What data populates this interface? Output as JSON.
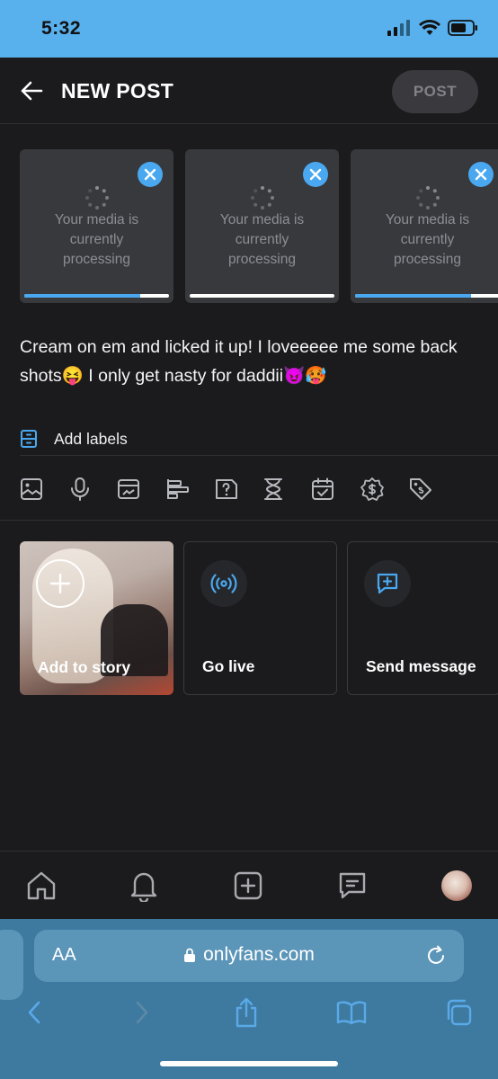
{
  "status_bar": {
    "time": "5:32"
  },
  "header": {
    "title": "NEW POST",
    "post_label": "POST"
  },
  "media": [
    {
      "text": "Your media is currently processing",
      "progress": 0.8
    },
    {
      "text": "Your media is currently processing",
      "progress": 1.0
    },
    {
      "text": "Your media is currently processing",
      "progress": 0.8
    }
  ],
  "caption": "Cream on em and licked it up! I loveeeee me some back shots😝 I only get nasty for daddii😈🥵",
  "labels": {
    "text": "Add labels"
  },
  "toolbar_icons": [
    "image-icon",
    "microphone-icon",
    "vault-icon",
    "poll-icon",
    "quiz-icon",
    "hourglass-icon",
    "calendar-check-icon",
    "price-icon",
    "tag-icon"
  ],
  "actions": [
    {
      "label": "Add to story",
      "icon": "plus-icon"
    },
    {
      "label": "Go live",
      "icon": "broadcast-icon"
    },
    {
      "label": "Send message",
      "icon": "message-plus-icon"
    }
  ],
  "bottom_nav": [
    "home-icon",
    "bell-icon",
    "add-post-icon",
    "messages-icon",
    "avatar"
  ],
  "browser": {
    "aa_label": "AA",
    "url": "onlyfans.com"
  },
  "colors": {
    "accent": "#4aa8f0",
    "background": "#1b1b1d",
    "status_bar": "#58b0ec",
    "safari_bar": "#3e7aa0"
  }
}
